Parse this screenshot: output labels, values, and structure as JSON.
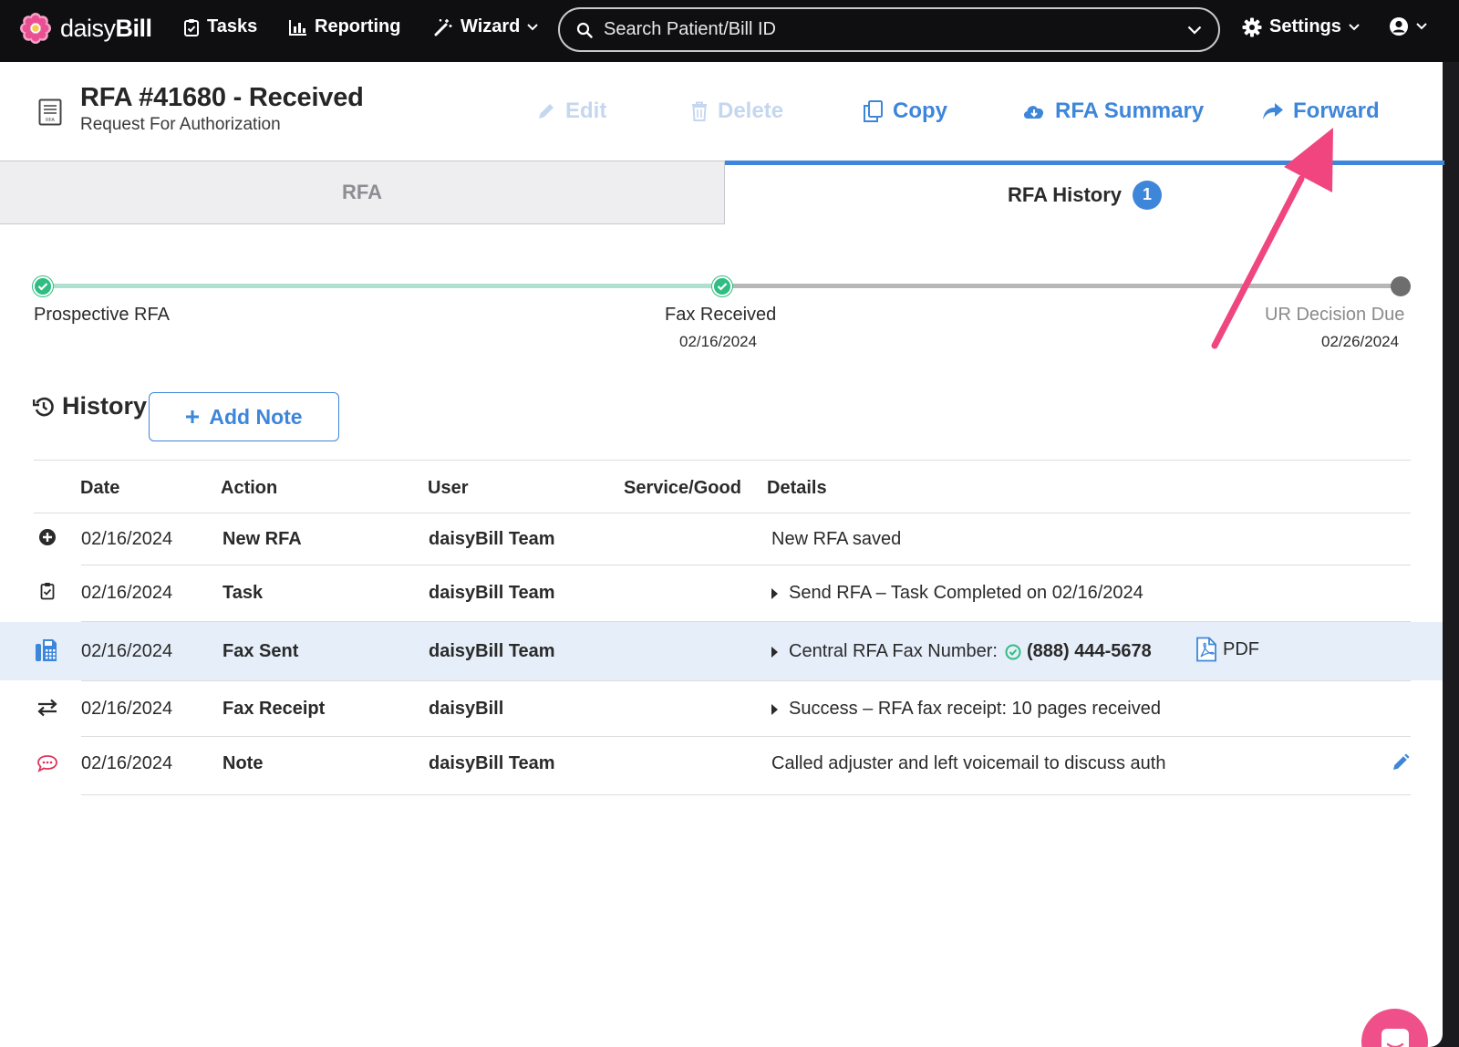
{
  "topbar": {
    "logo_text_light": "daisy",
    "logo_text_bold": "Bill",
    "nav": {
      "tasks": "Tasks",
      "reporting": "Reporting",
      "wizard": "Wizard",
      "settings": "Settings"
    },
    "search_placeholder": "Search Patient/Bill ID"
  },
  "header": {
    "title": "RFA #41680 - Received",
    "subtitle": "Request For Authorization",
    "actions": {
      "edit": "Edit",
      "delete": "Delete",
      "copy": "Copy",
      "summary": "RFA Summary",
      "forward": "Forward"
    }
  },
  "tabs": {
    "rfa": "RFA",
    "history": "RFA History",
    "history_badge": "1"
  },
  "timeline": {
    "steps": [
      {
        "label": "Prospective RFA",
        "date": "",
        "status": "done"
      },
      {
        "label": "Fax Received",
        "date": "02/16/2024",
        "status": "done"
      },
      {
        "label": "UR Decision Due",
        "date": "02/26/2024",
        "status": "pending"
      }
    ]
  },
  "history": {
    "heading": "History",
    "add_note": "Add Note",
    "columns": {
      "date": "Date",
      "action": "Action",
      "user": "User",
      "service": "Service/Good",
      "details": "Details"
    },
    "rows": [
      {
        "icon": "plus-circle-icon",
        "date": "02/16/2024",
        "action": "New RFA",
        "user": "daisyBill Team",
        "details": "New RFA saved"
      },
      {
        "icon": "clipboard-check-icon",
        "date": "02/16/2024",
        "action": "Task",
        "user": "daisyBill Team",
        "details": "Send RFA – Task Completed on 02/16/2024"
      },
      {
        "icon": "fax-icon",
        "date": "02/16/2024",
        "action": "Fax Sent",
        "user": "daisyBill Team",
        "details": "Central RFA Fax Number:",
        "phone": "(888) 444-5678",
        "attachment": "PDF"
      },
      {
        "icon": "exchange-icon",
        "date": "02/16/2024",
        "action": "Fax Receipt",
        "user": "daisyBill",
        "details": "Success – RFA fax receipt: 10 pages received"
      },
      {
        "icon": "comment-icon",
        "date": "02/16/2024",
        "action": "Note",
        "user": "daisyBill Team",
        "details": "Called adjuster and left voicemail to discuss auth"
      }
    ]
  },
  "colors": {
    "accent": "#3e86d9",
    "success": "#2fbd82",
    "annotation": "#f0457f",
    "row_highlight": "#e6eef9"
  }
}
